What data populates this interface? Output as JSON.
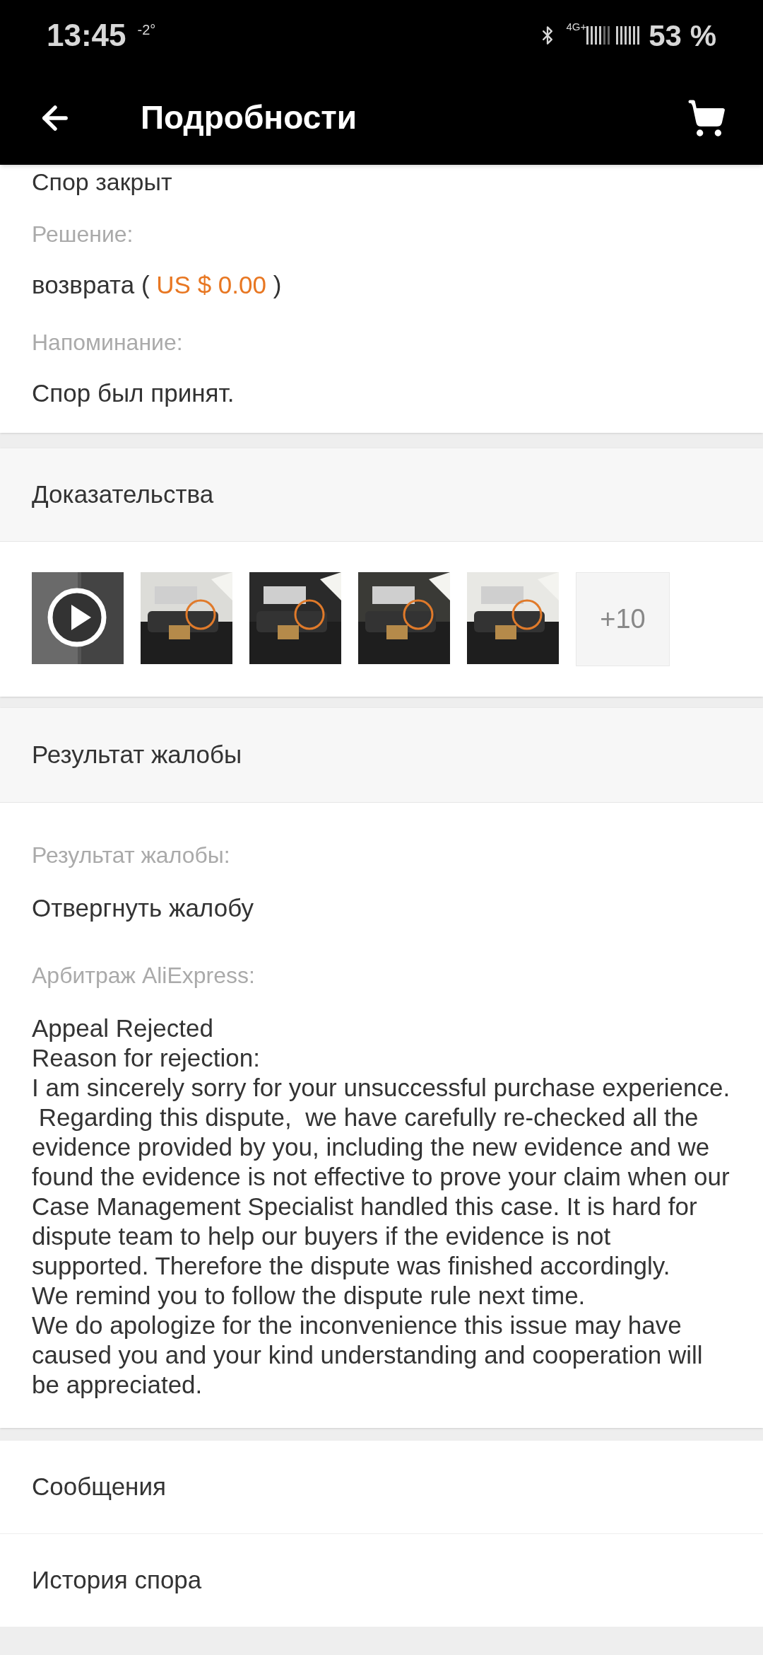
{
  "status_bar": {
    "time": "13:45",
    "temperature": "-2°",
    "network": "4G+",
    "battery": "53 %"
  },
  "app_bar": {
    "title": "Подробности"
  },
  "summary": {
    "status": "Спор закрыт",
    "fields": [
      {
        "label": "Решение:",
        "value": "возврата (",
        "amount": "US $ 0.00",
        "suffix": ")"
      },
      {
        "label": "Напоминание:",
        "value": "Спор был принят."
      }
    ]
  },
  "evidence": {
    "title": "Доказательства",
    "items": [
      {
        "kind": "video"
      },
      {
        "kind": "picture"
      },
      {
        "kind": "picture"
      },
      {
        "kind": "picture"
      },
      {
        "kind": "picture"
      }
    ],
    "more": "+10"
  },
  "complaint": {
    "title": "Результат жалобы",
    "fields": [
      {
        "label": "Результат жалобы:",
        "lines": [
          "Отвергнуть жалобу"
        ]
      },
      {
        "label": "Арбитраж AliExpress:",
        "lines": [
          "Appeal Rejected",
          "Reason for rejection:",
          "I am sincerely sorry for your unsuccessful purchase experience.",
          " Regarding this dispute,  we have carefully re-checked all the evidence provided by you, including the new evidence and we found the evidence is not effective to prove your claim when our Case Management Specialist handled this case. It is hard for dispute team to help our buyers if the evidence is not supported. Therefore the dispute was finished accordingly.",
          "We remind you to follow the dispute rule next time.",
          "We do apologize for the inconvenience this issue may have caused you and your kind understanding and cooperation will be appreciated."
        ]
      }
    ]
  },
  "links": [
    "Сообщения",
    "История спора"
  ]
}
